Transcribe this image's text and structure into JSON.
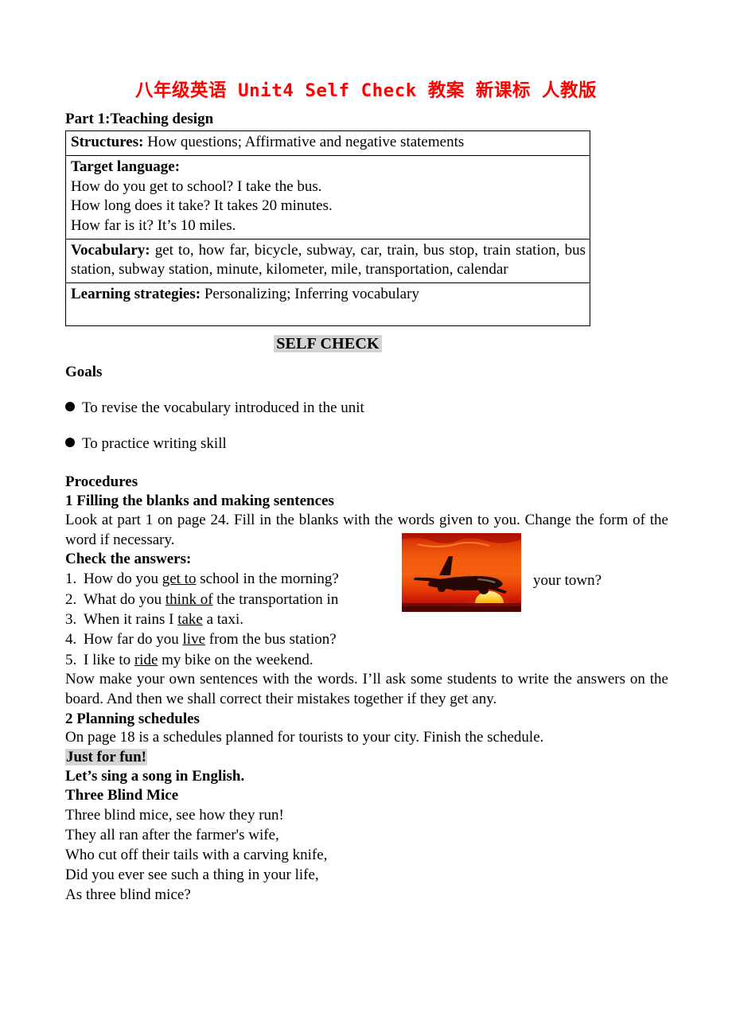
{
  "document": {
    "title": "八年级英语 Unit4 Self Check 教案 新课标 人教版",
    "title_color": "#FF0000",
    "part_heading": "Part 1:Teaching design"
  },
  "table": {
    "rows": [
      {
        "label": "Structures:",
        "text": " How questions; Affirmative and negative statements"
      },
      {
        "label": "Target language:",
        "lines": [
          "How do you get to school? I take the bus.",
          "How long does it take? It takes 20 minutes.",
          "How far is it? It’s 10 miles."
        ]
      },
      {
        "label": "Vocabulary:",
        "text": " get to, how far, bicycle, subway, car, train, bus stop, train station, bus station, subway station, minute, kilometer, mile, transportation, calendar"
      },
      {
        "label": "Learning strategies:",
        "text": " Personalizing;  Inferring vocabulary"
      }
    ]
  },
  "self_check": {
    "heading": "SELF CHECK",
    "highlight_color": "#d4d4d4"
  },
  "goals": {
    "heading": "Goals",
    "items": [
      "To revise the vocabulary introduced in the unit",
      "To practice writing skill"
    ]
  },
  "procedures": {
    "heading": "Procedures",
    "section1": {
      "heading": "1 Filling the blanks and making sentences",
      "intro": "Look at part 1 on page 24. Fill in the blanks with the words given to you. Change the form of the word if necessary.",
      "check_heading": "Check the answers:",
      "answers": [
        {
          "num": "1.",
          "pre": "How do you ",
          "underline": "get to",
          "post": " school in the morning?"
        },
        {
          "num": "2.",
          "pre": "What do you ",
          "underline": "think of",
          "post": " the transportation in"
        },
        {
          "num": "3.",
          "pre": "When it rains I ",
          "underline": "take",
          "post": " a taxi."
        },
        {
          "num": "4.",
          "pre": "How far do you ",
          "underline": "live",
          "post": " from the bus station?"
        },
        {
          "num": "5.",
          "pre": "I like to ",
          "underline": "ride",
          "post": " my bike on the weekend."
        }
      ],
      "after_image_text": "your town?",
      "closing": "Now make your own sentences with the words. I’ll ask some students to write the answers on the board. And then we shall correct their mistakes together if they get any."
    },
    "section2": {
      "heading": "2 Planning schedules",
      "text": "On page 18 is a schedules planned for tourists to your city. Finish the schedule."
    }
  },
  "fun": {
    "heading": "Just for fun!",
    "invite": "Let’s sing a song in English.",
    "song_title": "Three Blind Mice",
    "lyrics": [
      "Three blind mice, see how they run!",
      "They all ran after the farmer's wife,",
      "Who cut off their tails with a carving knife,",
      "Did you ever see such a thing in your life,",
      "As three blind mice?"
    ]
  },
  "image": {
    "name": "airplane-sunset-photo",
    "description": "Airplane silhouette flying against an orange-red sunset sky with a yellow sun on the horizon",
    "sky_top_color": "#c41a06",
    "sky_mid_color": "#f26a11",
    "sun_color": "#ffd24a",
    "plane_color": "#2a0a04"
  }
}
